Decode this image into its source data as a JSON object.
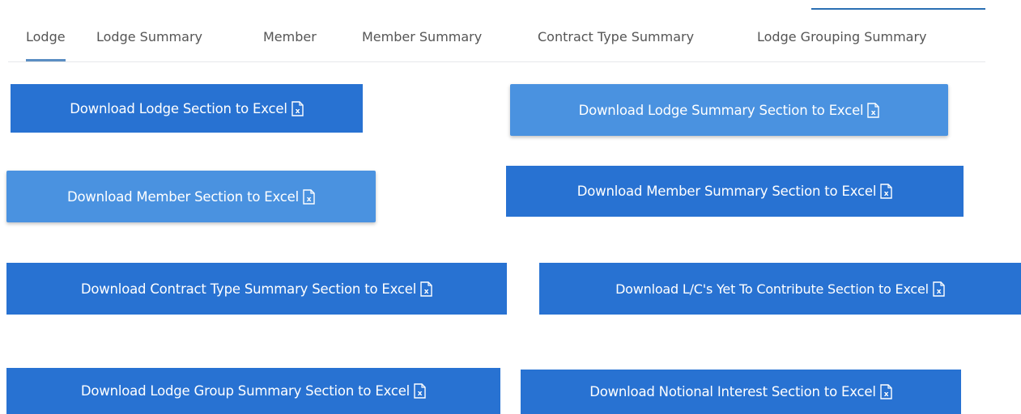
{
  "tabs": {
    "lodge": "Lodge",
    "lodge_summary": "Lodge Summary",
    "member": "Member",
    "member_summary": "Member Summary",
    "contract_type_summary": "Contract Type Summary",
    "lodge_grouping_summary": "Lodge Grouping Summary",
    "active": "Lodge"
  },
  "buttons": {
    "lodge": "Download Lodge Section to Excel",
    "lodge_summary": "Download Lodge Summary Section to Excel",
    "member": "Download Member Section to Excel",
    "member_summary": "Download Member Summary Section to Excel",
    "contract_type_summary": "Download Contract Type Summary Section to Excel",
    "lc_yet_to_contribute": "Download L/C's Yet To Contribute Section to Excel",
    "lodge_group_summary": "Download Lodge Group Summary Section to Excel",
    "notional_interest": "Download Notional Interest Section to Excel"
  },
  "icons": {
    "excel": "excel-file-icon"
  },
  "colors": {
    "button_primary": "#2872d2",
    "button_hover": "#4a92e0",
    "tab_active_underline": "#5b8ec3",
    "tab_text": "#555555"
  }
}
